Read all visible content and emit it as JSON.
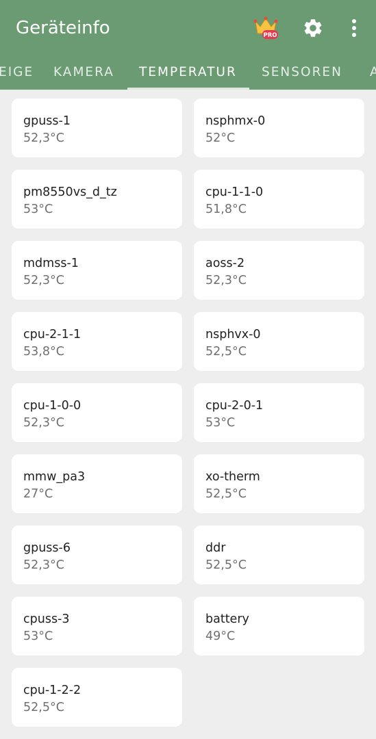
{
  "app": {
    "title": "Geräteinfo",
    "accent": "#6b9b73",
    "pro_badge": "PRO"
  },
  "tabs": [
    {
      "label": "EIGE"
    },
    {
      "label": "KAMERA"
    },
    {
      "label": "TEMPERATUR",
      "active": true
    },
    {
      "label": "SENSOREN"
    },
    {
      "label": "A"
    }
  ],
  "sensors": [
    {
      "name": "gpuss-1",
      "temp": "52,3°C"
    },
    {
      "name": "nsphmx-0",
      "temp": "52°C"
    },
    {
      "name": "pm8550vs_d_tz",
      "temp": "53°C"
    },
    {
      "name": "cpu-1-1-0",
      "temp": "51,8°C"
    },
    {
      "name": "mdmss-1",
      "temp": "52,3°C"
    },
    {
      "name": "aoss-2",
      "temp": "52,3°C"
    },
    {
      "name": "cpu-2-1-1",
      "temp": "53,8°C"
    },
    {
      "name": "nsphvx-0",
      "temp": "52,5°C"
    },
    {
      "name": "cpu-1-0-0",
      "temp": "52,3°C"
    },
    {
      "name": "cpu-2-0-1",
      "temp": "53°C"
    },
    {
      "name": "mmw_pa3",
      "temp": "27°C"
    },
    {
      "name": "xo-therm",
      "temp": "52,5°C"
    },
    {
      "name": "gpuss-6",
      "temp": "52,3°C"
    },
    {
      "name": "ddr",
      "temp": "52,5°C"
    },
    {
      "name": "cpuss-3",
      "temp": "53°C"
    },
    {
      "name": "battery",
      "temp": "49°C"
    },
    {
      "name": "cpu-1-2-2",
      "temp": "52,5°C"
    }
  ]
}
